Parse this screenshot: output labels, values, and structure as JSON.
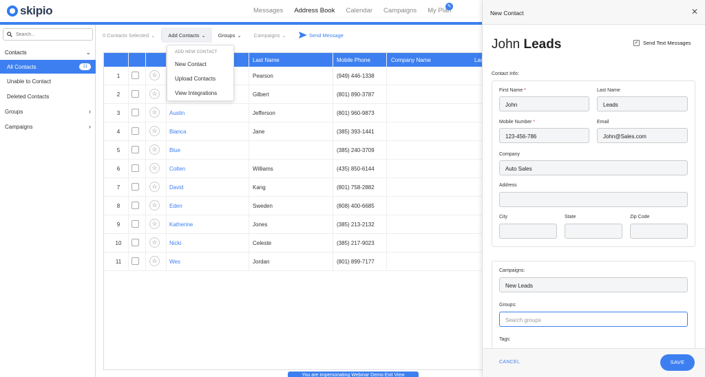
{
  "app": {
    "logo_text": "skipio",
    "accent": "#3d7ff0"
  },
  "nav": {
    "items": [
      "Messages",
      "Address Book",
      "Calendar",
      "Campaigns",
      "My Plan"
    ],
    "active": "Address Book",
    "plan_badge_icon": "rocket-icon"
  },
  "sidebar": {
    "search_placeholder": "Search...",
    "contacts_header": "Contacts",
    "all_contacts": "All Contacts",
    "all_contacts_count": "11",
    "unable": "Unable to Contact",
    "deleted": "Deleted Contacts",
    "groups": "Groups",
    "campaigns": "Campaigns"
  },
  "toolbar": {
    "selected": "0  Contacts Selected",
    "add_contacts": "Add Contacts",
    "groups": "Groups",
    "campaigns": "Campaigns",
    "send_message": "Send Message"
  },
  "dropdown": {
    "header": "ADD NEW CONTACT",
    "items": [
      "New Contact",
      "Upload Contacts",
      "View Integrations"
    ]
  },
  "table": {
    "headers": {
      "last": "Last Name",
      "phone": "Mobile Phone",
      "company": "Company Name",
      "extra": "Las"
    },
    "rows": [
      {
        "n": "1",
        "first": "",
        "last": "Pearson",
        "phone": "(949) 446-1338"
      },
      {
        "n": "2",
        "first": "",
        "last": "Gilbert",
        "phone": "(801) 890-3787"
      },
      {
        "n": "3",
        "first": "Austin",
        "last": "Jefferson",
        "phone": "(801) 960-9873"
      },
      {
        "n": "4",
        "first": "Bianca",
        "last": "Jane",
        "phone": "(385) 393-1441"
      },
      {
        "n": "5",
        "first": "Blue",
        "last": "",
        "phone": "(385) 240-3709"
      },
      {
        "n": "6",
        "first": "Colten",
        "last": "Williams",
        "phone": "(435) 850-6144"
      },
      {
        "n": "7",
        "first": "David",
        "last": "Kang",
        "phone": "(801) 758-2882"
      },
      {
        "n": "8",
        "first": "Eden",
        "last": "Sweden",
        "phone": "(808) 400-6685"
      },
      {
        "n": "9",
        "first": "Katherine",
        "last": "Jones",
        "phone": "(385) 213-2132"
      },
      {
        "n": "10",
        "first": "Nicki",
        "last": "Celeste",
        "phone": "(385) 217-9023"
      },
      {
        "n": "11",
        "first": "Wes",
        "last": "Jordan",
        "phone": "(801) 899-7177"
      }
    ]
  },
  "banner": {
    "text": "You are impersonating Webinar Demo Exit View"
  },
  "panel": {
    "title": "New Contact",
    "first_name_display": "John",
    "last_name_display": "Leads",
    "send_text_label": "Send Text Messages",
    "contact_info_label": "Contact Info:",
    "first_name_label": "First Name",
    "first_name": "John",
    "last_name_label": "Last Name",
    "last_name": "Leads",
    "mobile_label": "Mobile Number",
    "mobile": "123-456-786",
    "email_label": "Email",
    "email": "John@Sales.com",
    "company_label": "Company",
    "company": "Auto Sales",
    "address_label": "Address",
    "address": "",
    "city_label": "City",
    "state_label": "State",
    "zip_label": "Zip Code",
    "campaigns_label": "Campaigns:",
    "campaigns_value": "New Leads",
    "groups_label": "Groups:",
    "groups_placeholder": "Search groups",
    "tags_label": "Tags:",
    "cancel": "CANCEL",
    "save": "SAVE"
  }
}
